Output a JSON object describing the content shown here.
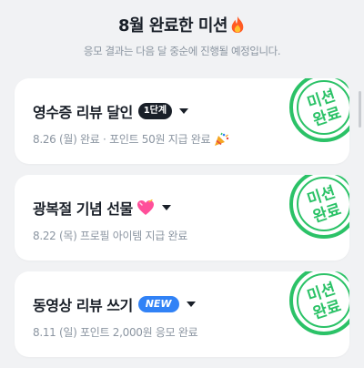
{
  "header": {
    "title": "8월 완료한 미션",
    "subtitle": "응모 결과는 다음 달 중순에 진행될 예정입니다."
  },
  "stamp": {
    "line1": "미션",
    "line2": "완료",
    "color": "#2bc267"
  },
  "missions": [
    {
      "title": "영수증 리뷰 달인",
      "badge": "1단계",
      "badge_type": "step",
      "sub": "8.26 (월) 완료 · 포인트 50원 지급 완료",
      "sub_icon": "party-popper-icon"
    },
    {
      "title": "광복절 기념 선물",
      "title_icon": "heart-icon",
      "sub": "8.22 (목) 프로필 아이템 지급 완료"
    },
    {
      "title": "동영상 리뷰 쓰기",
      "badge": "NEW",
      "badge_type": "new",
      "sub": "8.11 (일) 포인트 2,000원 응모 완료"
    }
  ]
}
